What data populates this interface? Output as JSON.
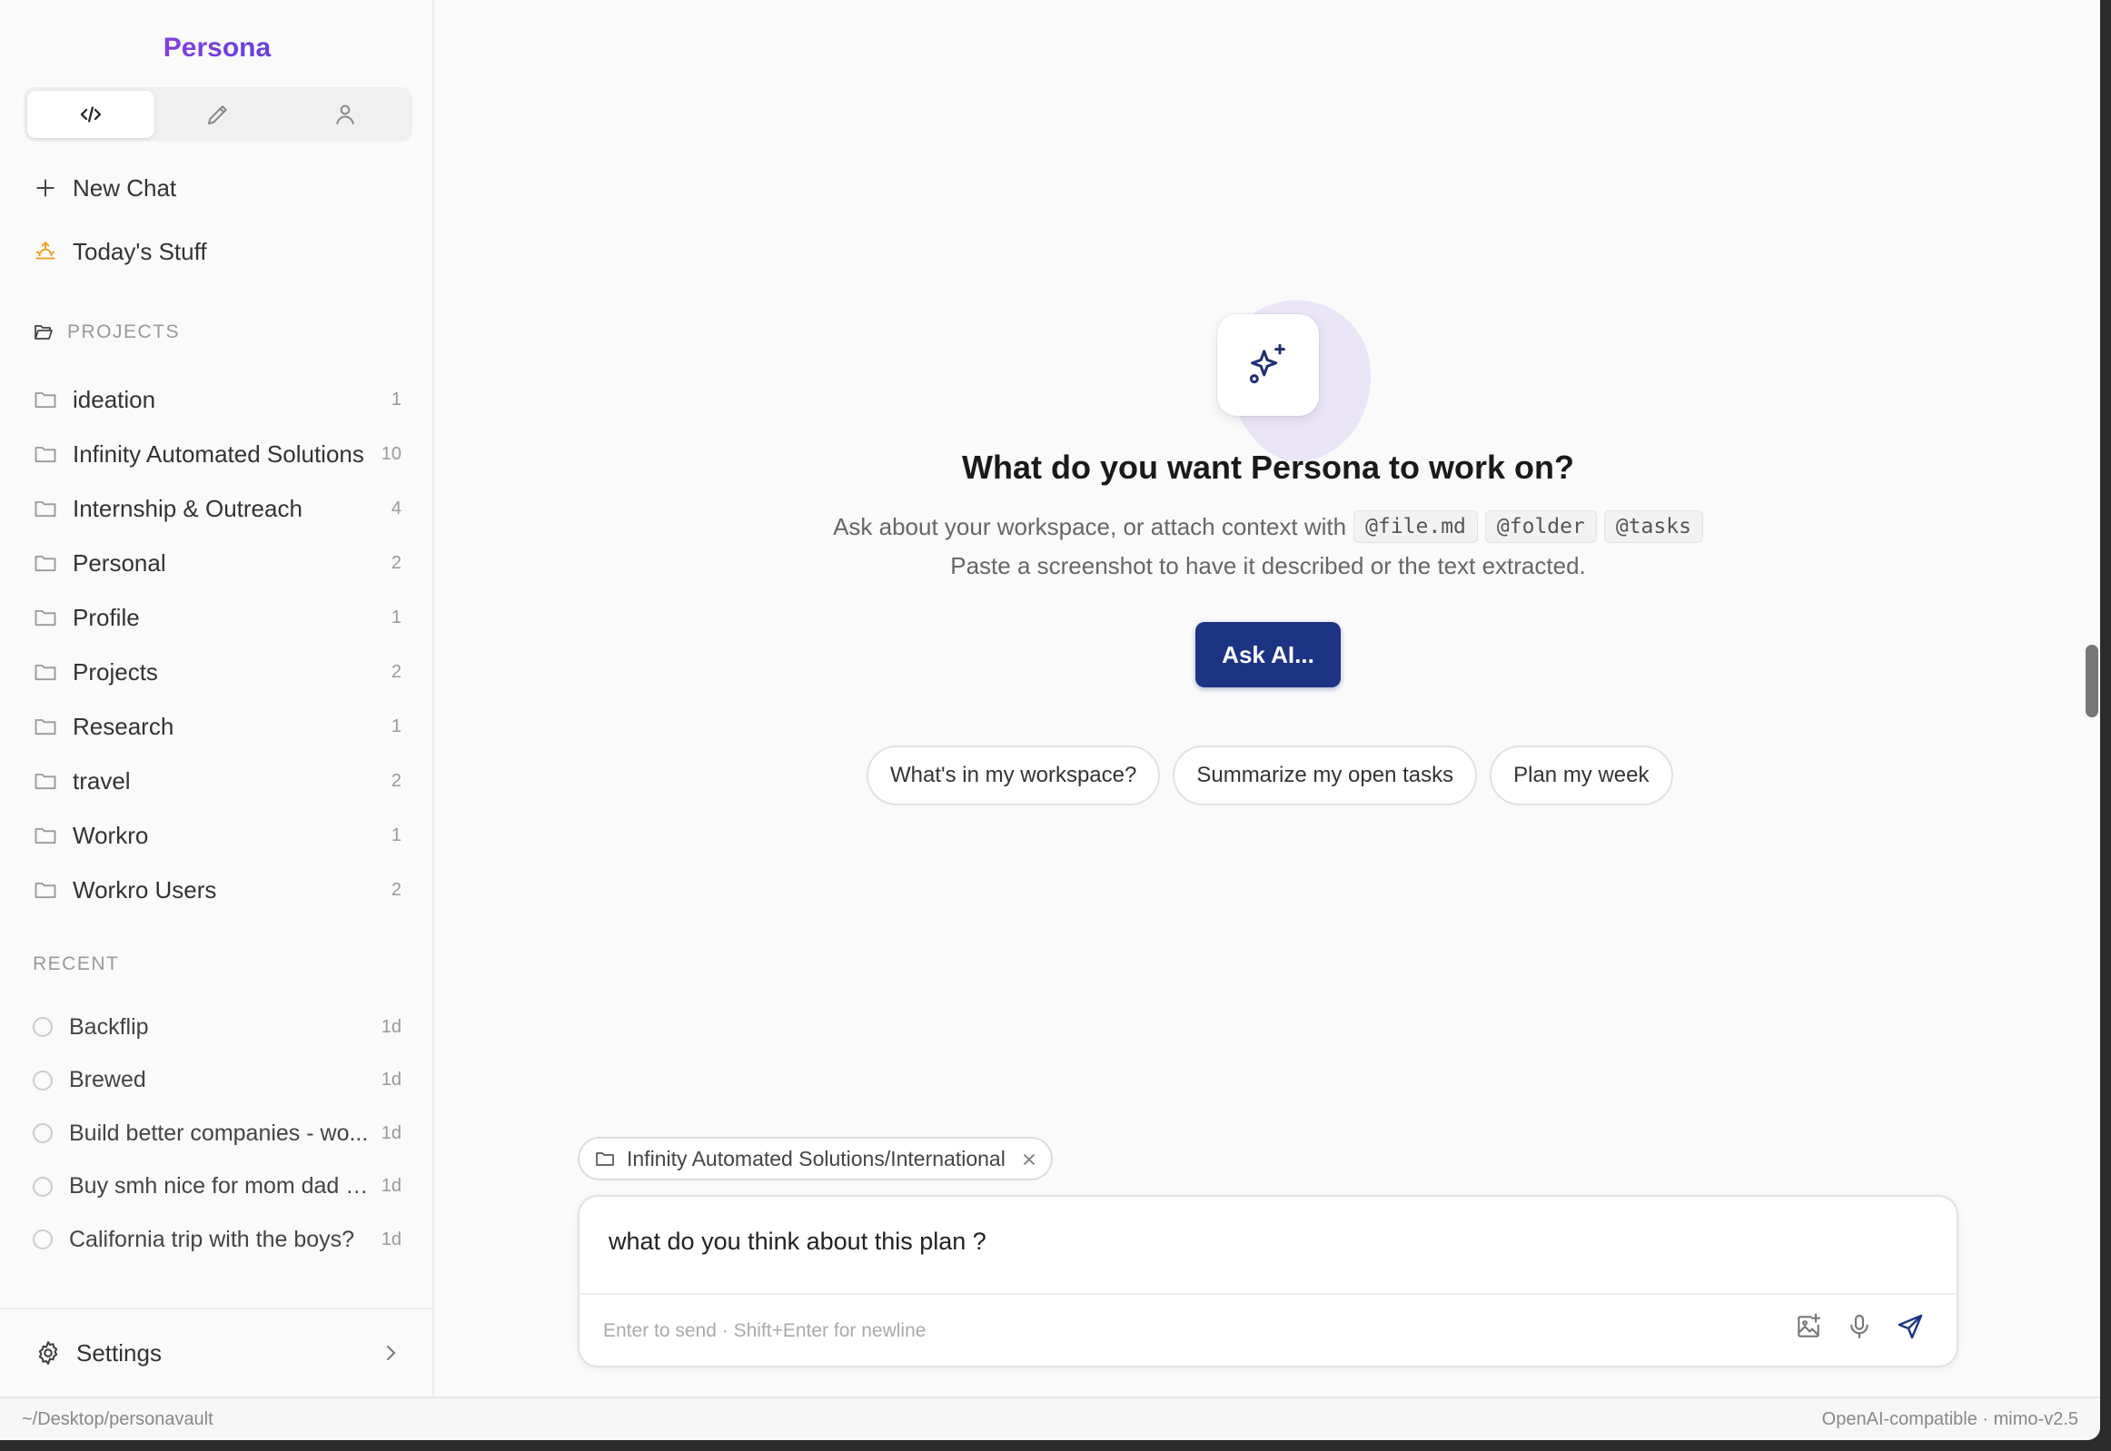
{
  "app": {
    "brand": "Persona",
    "accent": "#1d3384"
  },
  "sidebar": {
    "mode_tabs": [
      {
        "icon": "code-icon",
        "active": true
      },
      {
        "icon": "pencil-icon",
        "active": false
      },
      {
        "icon": "user-icon",
        "active": false
      }
    ],
    "new_chat": "New Chat",
    "todays_stuff": "Today's Stuff",
    "projects_label": "PROJECTS",
    "projects": [
      {
        "name": "ideation",
        "count": "1"
      },
      {
        "name": "Infinity Automated Solutions",
        "count": "10"
      },
      {
        "name": "Internship & Outreach",
        "count": "4"
      },
      {
        "name": "Personal",
        "count": "2"
      },
      {
        "name": "Profile",
        "count": "1"
      },
      {
        "name": "Projects",
        "count": "2"
      },
      {
        "name": "Research",
        "count": "1"
      },
      {
        "name": "travel",
        "count": "2"
      },
      {
        "name": "Workro",
        "count": "1"
      },
      {
        "name": "Workro Users",
        "count": "2"
      }
    ],
    "recent_label": "RECENT",
    "recent": [
      {
        "name": "Backflip",
        "age": "1d"
      },
      {
        "name": "Brewed",
        "age": "1d"
      },
      {
        "name": "Build better companies - wo...",
        "age": "1d"
      },
      {
        "name": "Buy smh nice for mom dad ji...",
        "age": "1d"
      },
      {
        "name": "California trip with the boys?",
        "age": "1d"
      }
    ],
    "settings": "Settings"
  },
  "main": {
    "headline": "What do you want Persona to work on?",
    "subline_prefix": "Ask about your workspace, or attach context with",
    "context_tokens": [
      "@file.md",
      "@folder",
      "@tasks"
    ],
    "subline2": "Paste a screenshot to have it described or the text extracted.",
    "ask_button": "Ask AI...",
    "suggestions": [
      "What's in my workspace?",
      "Summarize my open tasks",
      "Plan my week"
    ],
    "context_chip": "Infinity Automated Solutions/International",
    "composer": {
      "value": "what do you think about this plan ?",
      "hint": "Enter to send · Shift+Enter for newline"
    }
  },
  "statusbar": {
    "path": "~/Desktop/personavault",
    "model": "OpenAI-compatible · mimo-v2.5"
  }
}
